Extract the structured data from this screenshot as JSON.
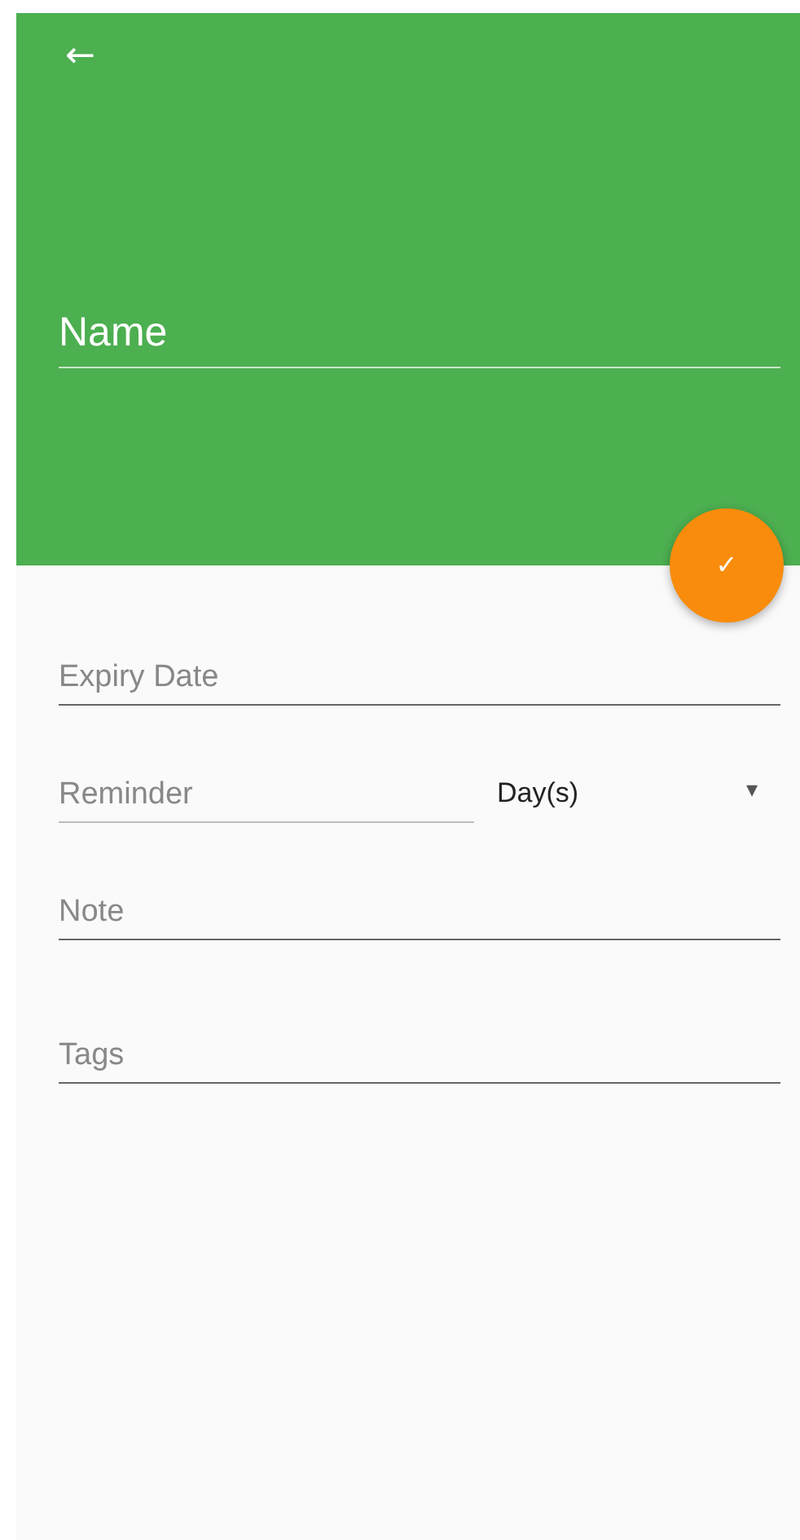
{
  "header": {
    "back_button": "←",
    "name_field": {
      "placeholder": "Name"
    }
  },
  "save_button": "✓",
  "form": {
    "fields": [
      {
        "kind": "text",
        "placeholder": "Expiry Date"
      },
      {
        "kind": "reminder",
        "placeholder": "Reminder",
        "unit": "Day(s)",
        "caret": "▾"
      },
      {
        "kind": "text",
        "placeholder": "Note"
      },
      {
        "kind": "text",
        "placeholder": "Tags"
      }
    ]
  }
}
